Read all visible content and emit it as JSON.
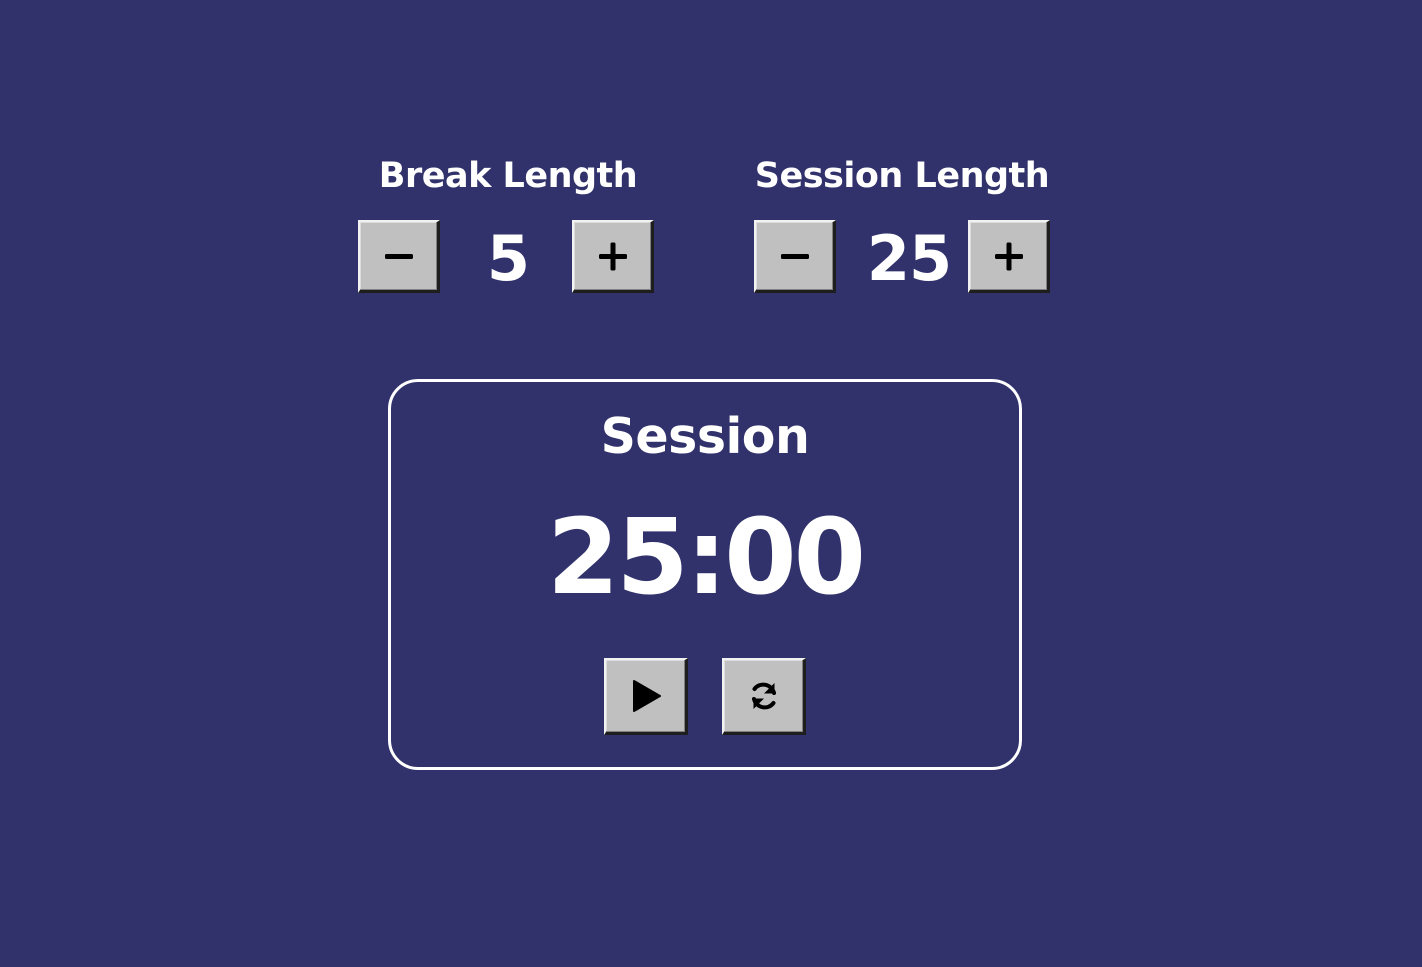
{
  "break": {
    "label": "Break Length",
    "value": "5",
    "decrement_icon": "minus-icon",
    "increment_icon": "plus-icon"
  },
  "session": {
    "label": "Session Length",
    "value": "25",
    "decrement_icon": "minus-icon",
    "increment_icon": "plus-icon"
  },
  "timer": {
    "label": "Session",
    "time_left": "25:00",
    "start_icon": "play-icon",
    "reset_icon": "refresh-icon"
  },
  "colors": {
    "background": "#31326b",
    "text": "#ffffff",
    "button": "#c0c0c0"
  }
}
